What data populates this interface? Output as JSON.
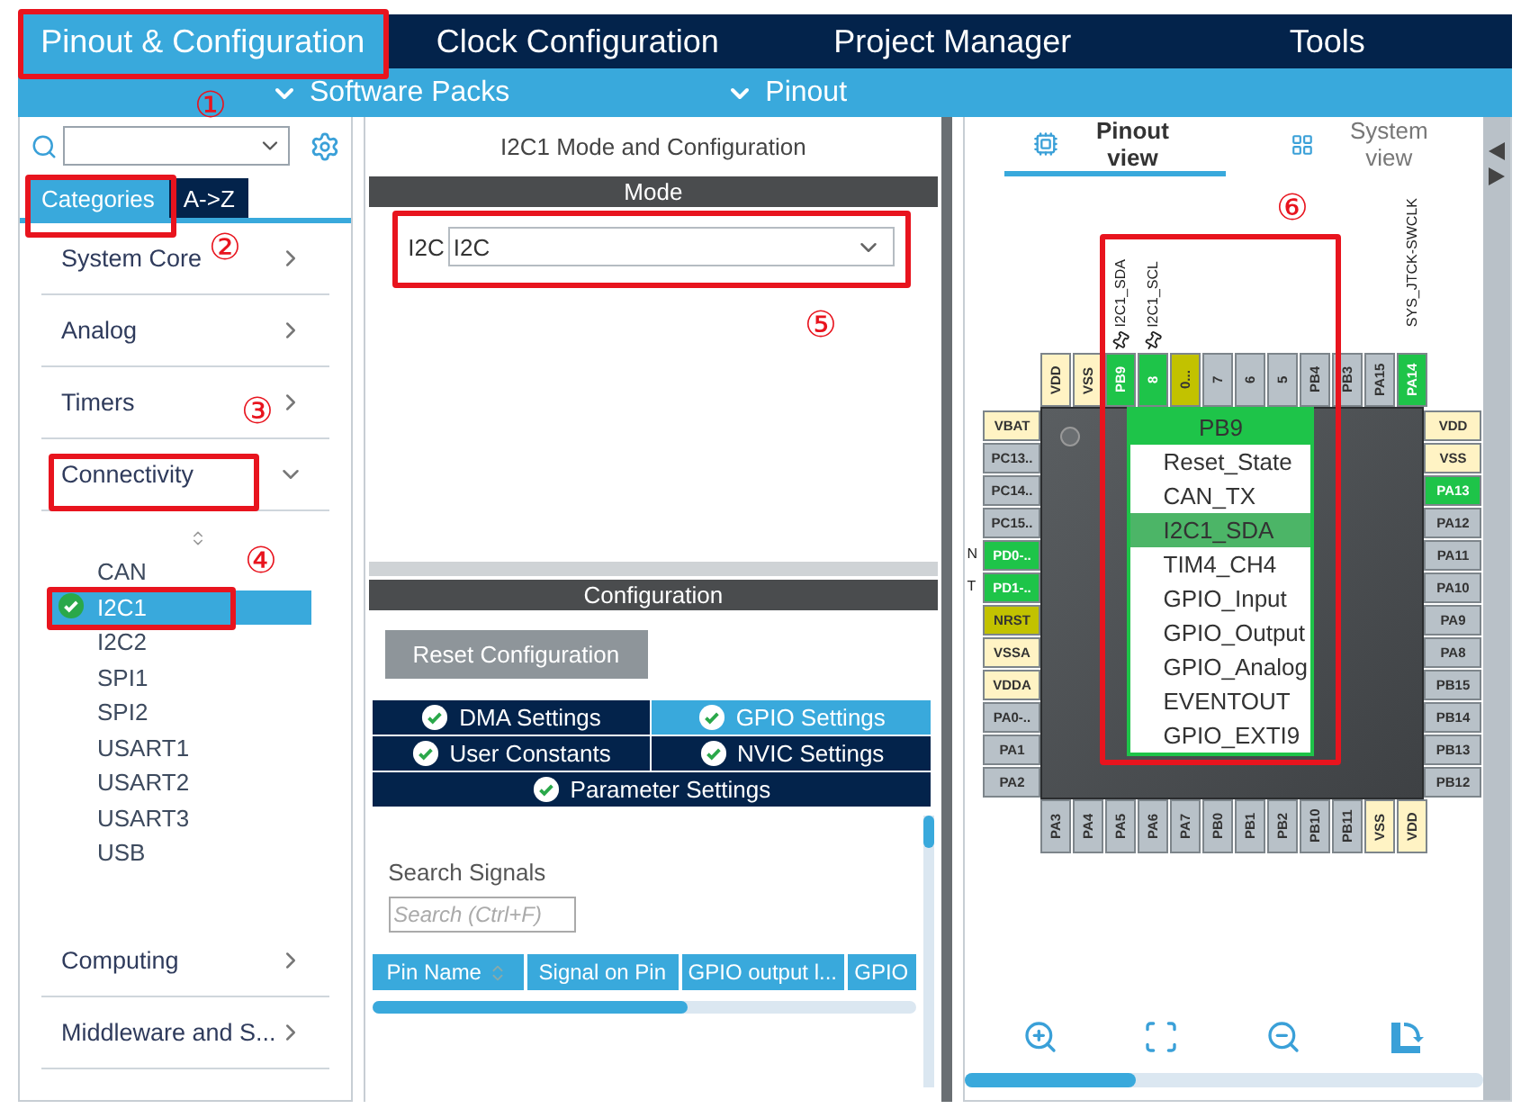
{
  "top_tabs": [
    {
      "label": "Pinout & Configuration",
      "selected": true
    },
    {
      "label": "Clock Configuration",
      "selected": false
    },
    {
      "label": "Project Manager",
      "selected": false
    },
    {
      "label": "Tools",
      "selected": false
    }
  ],
  "menus": [
    "Software Packs",
    "Pinout"
  ],
  "left_panel": {
    "tabs": [
      {
        "label": "Categories",
        "selected": true
      },
      {
        "label": "A->Z",
        "selected": false
      }
    ],
    "categories": [
      {
        "label": "System Core",
        "expanded": false
      },
      {
        "label": "Analog",
        "expanded": false
      },
      {
        "label": "Timers",
        "expanded": false
      },
      {
        "label": "Connectivity",
        "expanded": true,
        "children": [
          {
            "label": "CAN",
            "selected": false,
            "configured": false
          },
          {
            "label": "I2C1",
            "selected": true,
            "configured": true
          },
          {
            "label": "I2C2",
            "selected": false,
            "configured": false
          },
          {
            "label": "SPI1",
            "selected": false,
            "configured": false
          },
          {
            "label": "SPI2",
            "selected": false,
            "configured": false
          },
          {
            "label": "USART1",
            "selected": false,
            "configured": false
          },
          {
            "label": "USART2",
            "selected": false,
            "configured": false
          },
          {
            "label": "USART3",
            "selected": false,
            "configured": false
          },
          {
            "label": "USB",
            "selected": false,
            "configured": false
          }
        ]
      },
      {
        "label": "Computing",
        "expanded": false
      },
      {
        "label": "Middleware and S...",
        "expanded": false
      }
    ]
  },
  "mode_panel": {
    "title": "I2C1 Mode and Configuration",
    "mode_header": "Mode",
    "mode_label": "I2C",
    "mode_value": "I2C",
    "config_header": "Configuration",
    "reset_button": {
      "label": "Reset Configuration",
      "disabled": true
    },
    "config_tab_rows": [
      [
        {
          "label": "DMA Settings",
          "selected": false
        },
        {
          "label": "GPIO Settings",
          "selected": true
        }
      ],
      [
        {
          "label": "User Constants",
          "selected": false
        },
        {
          "label": "NVIC Settings",
          "selected": false
        }
      ],
      [
        {
          "label": "Parameter Settings",
          "selected": false
        }
      ]
    ],
    "search_label": "Search Signals",
    "search_placeholder": "Search (Ctrl+F)",
    "columns": [
      {
        "label": "Pin Name",
        "sortable": true
      },
      {
        "label": "Signal on Pin",
        "sortable": false
      },
      {
        "label": "GPIO output l...",
        "sortable": false
      },
      {
        "label": "GPIO",
        "sortable": false
      }
    ]
  },
  "pinout_panel": {
    "views": [
      {
        "label": "Pinout view",
        "selected": true
      },
      {
        "label": "System view",
        "selected": false
      }
    ],
    "pins": {
      "top": [
        {
          "label": "VDD",
          "kind": "power"
        },
        {
          "label": "VSS",
          "kind": "power"
        },
        {
          "label": "PB9",
          "kind": "assigned",
          "signal": "I2C1_SDA",
          "pinned": true
        },
        {
          "label": "8",
          "kind": "assigned",
          "signal": "I2C1_SCL",
          "pinned": true
        },
        {
          "label": "0...",
          "kind": "boot"
        },
        {
          "label": "7",
          "kind": "io"
        },
        {
          "label": "6",
          "kind": "io"
        },
        {
          "label": "5",
          "kind": "io"
        },
        {
          "label": "PB4",
          "kind": "io"
        },
        {
          "label": "PB3",
          "kind": "io"
        },
        {
          "label": "PA15",
          "kind": "io"
        },
        {
          "label": "PA14",
          "kind": "assigned",
          "signal": "SYS_JTCK-SWCLK",
          "pinned": false
        }
      ],
      "left": [
        {
          "label": "VBAT",
          "kind": "power"
        },
        {
          "label": "PC13..",
          "kind": "io"
        },
        {
          "label": "PC14..",
          "kind": "io"
        },
        {
          "label": "PC15..",
          "kind": "io"
        },
        {
          "label": "PD0-..",
          "kind": "assigned",
          "signal": "N"
        },
        {
          "label": "PD1-..",
          "kind": "assigned",
          "signal": "T"
        },
        {
          "label": "NRST",
          "kind": "boot"
        },
        {
          "label": "VSSA",
          "kind": "power"
        },
        {
          "label": "VDDA",
          "kind": "power"
        },
        {
          "label": "PA0-..",
          "kind": "io"
        },
        {
          "label": "PA1",
          "kind": "io"
        },
        {
          "label": "PA2",
          "kind": "io"
        }
      ],
      "right": [
        {
          "label": "VDD",
          "kind": "power"
        },
        {
          "label": "VSS",
          "kind": "power"
        },
        {
          "label": "PA13",
          "kind": "assigned"
        },
        {
          "label": "PA12",
          "kind": "io"
        },
        {
          "label": "PA11",
          "kind": "io"
        },
        {
          "label": "PA10",
          "kind": "io"
        },
        {
          "label": "PA9",
          "kind": "io"
        },
        {
          "label": "PA8",
          "kind": "io"
        },
        {
          "label": "PB15",
          "kind": "io"
        },
        {
          "label": "PB14",
          "kind": "io"
        },
        {
          "label": "PB13",
          "kind": "io"
        },
        {
          "label": "PB12",
          "kind": "io"
        }
      ],
      "bottom": [
        {
          "label": "PA3",
          "kind": "io"
        },
        {
          "label": "PA4",
          "kind": "io"
        },
        {
          "label": "PA5",
          "kind": "io"
        },
        {
          "label": "PA6",
          "kind": "io"
        },
        {
          "label": "PA7",
          "kind": "io"
        },
        {
          "label": "PB0",
          "kind": "io"
        },
        {
          "label": "PB1",
          "kind": "io"
        },
        {
          "label": "PB2",
          "kind": "io"
        },
        {
          "label": "PB10",
          "kind": "io"
        },
        {
          "label": "PB11",
          "kind": "io"
        },
        {
          "label": "VSS",
          "kind": "power"
        },
        {
          "label": "VDD",
          "kind": "power"
        }
      ]
    },
    "popup": {
      "title": "PB9",
      "items": [
        {
          "label": "Reset_State",
          "selected": false
        },
        {
          "label": "CAN_TX",
          "selected": false
        },
        {
          "label": "I2C1_SDA",
          "selected": true
        },
        {
          "label": "TIM4_CH4",
          "selected": false
        },
        {
          "label": "GPIO_Input",
          "selected": false
        },
        {
          "label": "GPIO_Output",
          "selected": false
        },
        {
          "label": "GPIO_Analog",
          "selected": false
        },
        {
          "label": "EVENTOUT",
          "selected": false
        },
        {
          "label": "GPIO_EXTI9",
          "selected": false
        }
      ]
    }
  },
  "annotations": [
    "①",
    "②",
    "③",
    "④",
    "⑤",
    "⑥"
  ]
}
